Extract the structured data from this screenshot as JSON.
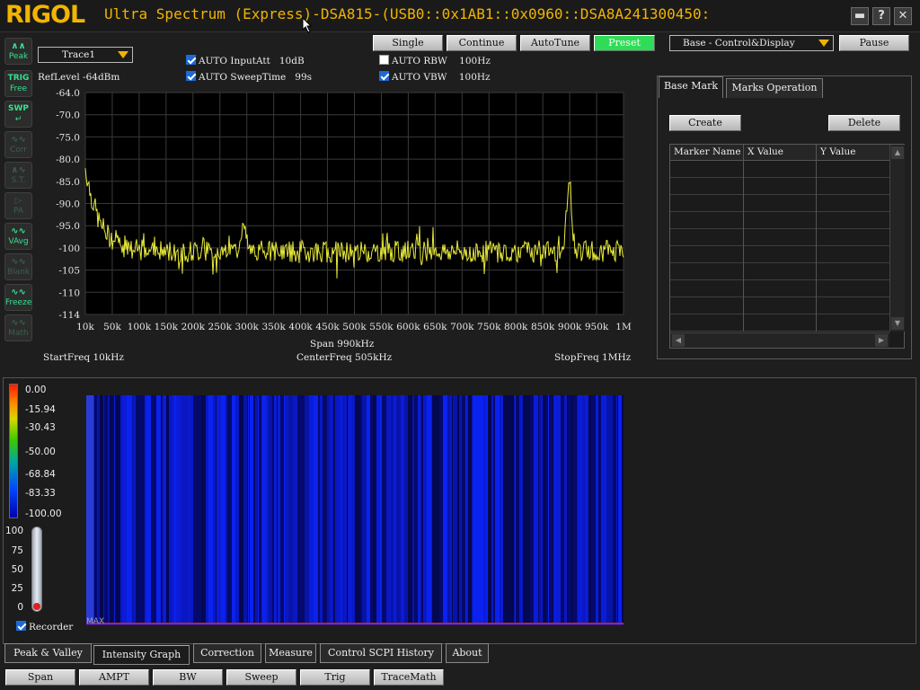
{
  "app": {
    "logo": "RIGOL",
    "title": "Ultra Spectrum (Express)-DSA815-(USB0::0x1AB1::0x0960::DSA8A241300450:",
    "window_buttons": [
      "minimize-icon",
      "help-icon",
      "close-icon"
    ]
  },
  "side_tools": [
    {
      "name": "peak",
      "label": "Peak",
      "active": true
    },
    {
      "name": "trig-free",
      "label": "TRIG Free",
      "active": true
    },
    {
      "name": "swp",
      "label": "SWP",
      "active": true
    },
    {
      "name": "corr",
      "label": "Corr",
      "active": false
    },
    {
      "name": "st",
      "label": "S.T.",
      "active": false
    },
    {
      "name": "pa",
      "label": "PA",
      "active": false
    },
    {
      "name": "vavg",
      "label": "VAvg",
      "active": true
    },
    {
      "name": "blank",
      "label": "Blank",
      "active": false
    },
    {
      "name": "freeze",
      "label": "Freeze",
      "active": true
    },
    {
      "name": "math",
      "label": "Math",
      "active": false
    }
  ],
  "trace_select": "Trace1",
  "reflevel": "RefLevel  -64dBm",
  "auto_inputatt": {
    "label": "AUTO InputAtt",
    "value": "10dB",
    "checked": true
  },
  "auto_sweeptime": {
    "label": "AUTO SweepTime",
    "value": "99s",
    "checked": true
  },
  "auto_rbw": {
    "label": "AUTO RBW",
    "value": "100Hz",
    "checked": false
  },
  "auto_vbw": {
    "label": "AUTO VBW",
    "value": "100Hz",
    "checked": true
  },
  "toolbar": {
    "single": "Single",
    "continue": "Continue",
    "autotune": "AutoTune",
    "preset": "Preset",
    "menu_select": "Base - Control&Display",
    "pause": "Pause"
  },
  "chart_data": {
    "type": "line",
    "title": "",
    "xlabel": "",
    "ylabel": "",
    "xlim": [
      10,
      1000
    ],
    "ylim": [
      -114,
      -64
    ],
    "x_unit": "kHz",
    "y_unit": "dBm",
    "grid": true,
    "background": "#000000",
    "trace_color": "#e8ea3a",
    "x_tick_labels": [
      "10k",
      "50k",
      "100k",
      "150k",
      "200k",
      "250k",
      "300k",
      "350k",
      "400k",
      "450k",
      "500k",
      "550k",
      "600k",
      "650k",
      "700k",
      "750k",
      "800k",
      "850k",
      "900k",
      "950k",
      "1M"
    ],
    "y_tick_labels": [
      "-64.0",
      "-70.0",
      "-75.0",
      "-80.0",
      "-85.0",
      "-90.0",
      "-95.0",
      "-100",
      "-105",
      "-110",
      "-114"
    ],
    "series": [
      {
        "name": "Trace1",
        "x": [
          10,
          15,
          20,
          25,
          30,
          35,
          40,
          45,
          50,
          55,
          60,
          65,
          70,
          75,
          80,
          90,
          100,
          110,
          120,
          150,
          200,
          250,
          290,
          300,
          310,
          350,
          400,
          450,
          500,
          550,
          600,
          650,
          700,
          750,
          800,
          850,
          890,
          900,
          910,
          950,
          1000
        ],
        "y": [
          -81,
          -84,
          -87,
          -89,
          -91,
          -93,
          -94,
          -95,
          -96,
          -96.5,
          -97,
          -97.5,
          -98,
          -98.5,
          -99,
          -99.5,
          -99.5,
          -99.5,
          -99.7,
          -99.8,
          -99.8,
          -99.8,
          -99.5,
          -93,
          -99.7,
          -99.8,
          -99.8,
          -99.8,
          -99.8,
          -99.8,
          -99.8,
          -99.8,
          -99.8,
          -99.8,
          -99.8,
          -99.8,
          -99.5,
          -83,
          -99.5,
          -99.8,
          -99.8
        ]
      }
    ]
  },
  "span_label": "Span  990kHz",
  "start_freq": "StartFreq  10kHz",
  "center_freq": "CenterFreq  505kHz",
  "stop_freq": "StopFreq  1MHz",
  "right_tabs": [
    "Base Mark",
    "Marks Operation"
  ],
  "mark_buttons": {
    "create": "Create",
    "delete": "Delete"
  },
  "mark_columns": [
    "Marker Name",
    "X Value",
    "Y Value"
  ],
  "intensity": {
    "colorbar_labels": [
      "0.00",
      "-15.94",
      "-30.43",
      "-50.00",
      "-68.84",
      "-83.33",
      "-100.00"
    ],
    "slider_labels": [
      "100",
      "75",
      "50",
      "25",
      "0"
    ],
    "recorder_label": "Recorder",
    "recorder_checked": true,
    "overlay_label": "MAX"
  },
  "bottom_tabs": [
    "Peak & Valley",
    "Intensity Graph",
    "Correction",
    "Measure",
    "Control SCPI History",
    "About"
  ],
  "function_buttons": [
    "Span",
    "AMPT",
    "BW",
    "Sweep",
    "Trig",
    "TraceMath"
  ]
}
